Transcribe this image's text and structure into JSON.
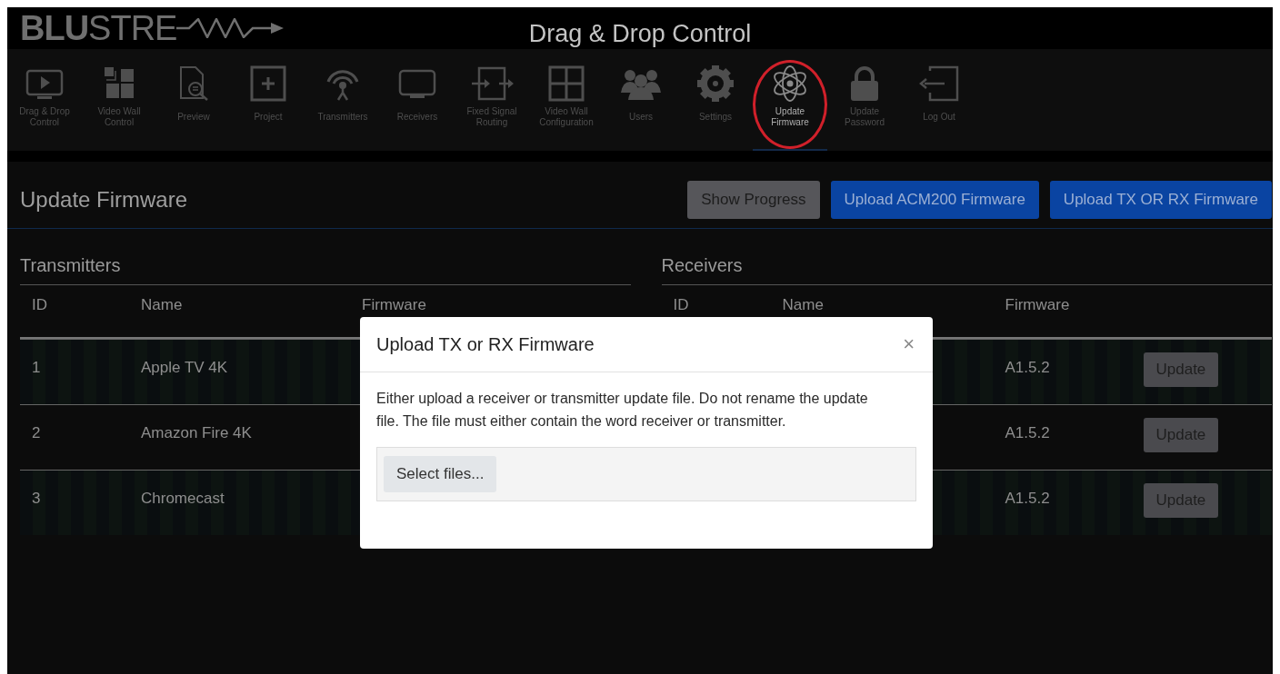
{
  "header": {
    "logo": {
      "bold": "BLU",
      "light": "STRE"
    },
    "title": "Drag & Drop Control"
  },
  "nav": [
    {
      "label": "Drag & Drop\nControl",
      "selected": false,
      "circled": false
    },
    {
      "label": "Video Wall\nControl",
      "selected": false,
      "circled": false
    },
    {
      "label": "Preview",
      "selected": false,
      "circled": false
    },
    {
      "label": "Project",
      "selected": false,
      "circled": false
    },
    {
      "label": "Transmitters",
      "selected": false,
      "circled": false
    },
    {
      "label": "Receivers",
      "selected": false,
      "circled": false
    },
    {
      "label": "Fixed Signal\nRouting",
      "selected": false,
      "circled": false
    },
    {
      "label": "Video Wall\nConfiguration",
      "selected": false,
      "circled": false
    },
    {
      "label": "Users",
      "selected": false,
      "circled": false
    },
    {
      "label": "Settings",
      "selected": false,
      "circled": false
    },
    {
      "label": "Update\nFirmware",
      "selected": true,
      "circled": true
    },
    {
      "label": "Update\nPassword",
      "selected": false,
      "circled": false
    },
    {
      "label": "Log Out",
      "selected": false,
      "circled": false
    }
  ],
  "page": {
    "title": "Update Firmware",
    "buttons": [
      {
        "label": "Show Progress",
        "kind": "secondary"
      },
      {
        "label": "Upload ACM200 Firmware",
        "kind": "primary"
      },
      {
        "label": "Upload TX OR RX Firmware",
        "kind": "primary"
      }
    ]
  },
  "transmitters": {
    "title": "Transmitters",
    "columns": [
      "ID",
      "Name",
      "Firmware"
    ],
    "rows": [
      {
        "id": "1",
        "name": "Apple TV 4K"
      },
      {
        "id": "2",
        "name": "Amazon Fire 4K"
      },
      {
        "id": "3",
        "name": "Chromecast"
      }
    ]
  },
  "receivers": {
    "title": "Receivers",
    "columns": [
      "ID",
      "Name",
      "Firmware"
    ],
    "rows": [
      {
        "firmware": "A1.5.2",
        "button": "Update"
      },
      {
        "firmware": "A1.5.2",
        "button": "Update"
      },
      {
        "firmware": "A1.5.2",
        "button": "Update"
      }
    ]
  },
  "modal": {
    "title": "Upload TX or RX Firmware",
    "close": "×",
    "text": "Either upload a receiver or transmitter update file. Do not rename the update file. The file must either contain the word receiver or transmitter.",
    "file_button": "Select files..."
  }
}
